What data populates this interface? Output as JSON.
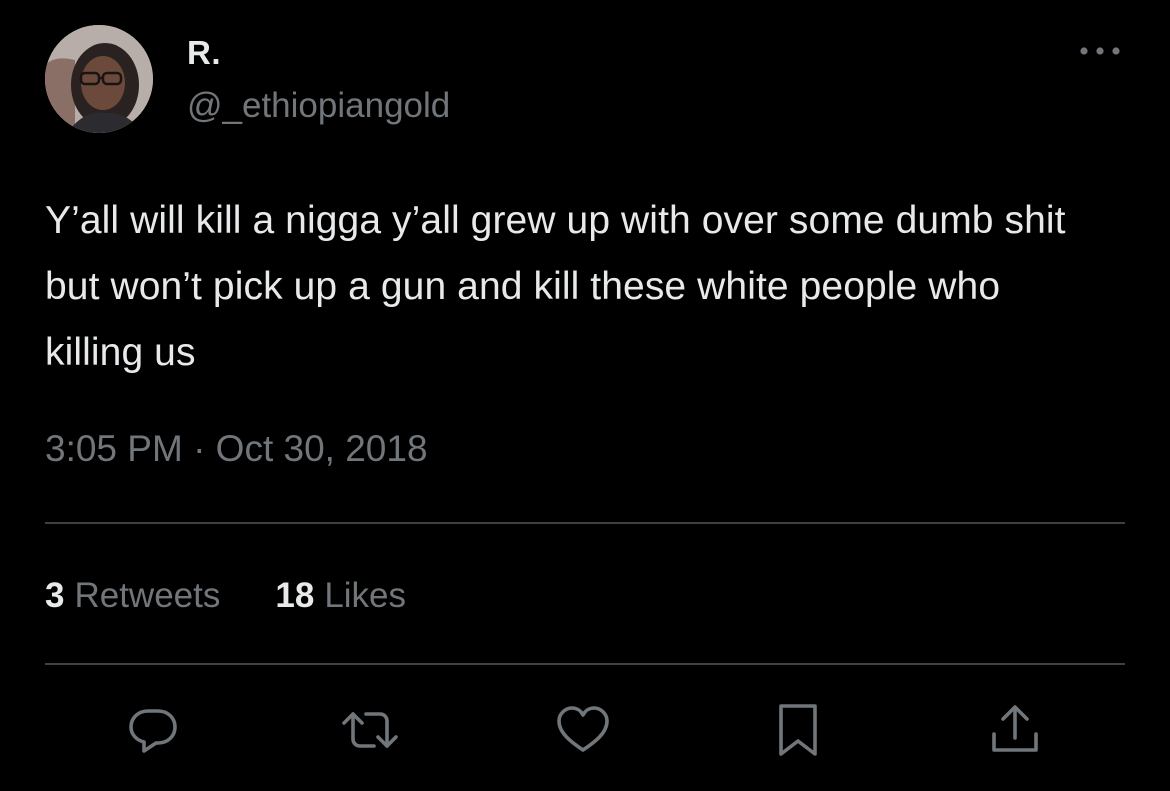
{
  "user": {
    "display_name": "R.",
    "handle": "@_ethiopiangold"
  },
  "tweet": {
    "text": "Y’all will kill a nigga y’all grew up with over some dumb shit but won’t pick up a gun and kill these white people who killing us",
    "timestamp": "3:05 PM · Oct 30, 2018"
  },
  "stats": {
    "retweets_count": "3",
    "retweets_label": "Retweets",
    "likes_count": "18",
    "likes_label": "Likes"
  },
  "icons": {
    "more": "more-horizontal-icon",
    "reply": "reply-icon",
    "retweet": "retweet-icon",
    "like": "heart-icon",
    "bookmark": "bookmark-icon",
    "share": "share-icon"
  },
  "colors": {
    "background": "#000000",
    "primary_text": "#e7e9ea",
    "secondary_text": "#71767b",
    "divider": "#3e4144"
  }
}
